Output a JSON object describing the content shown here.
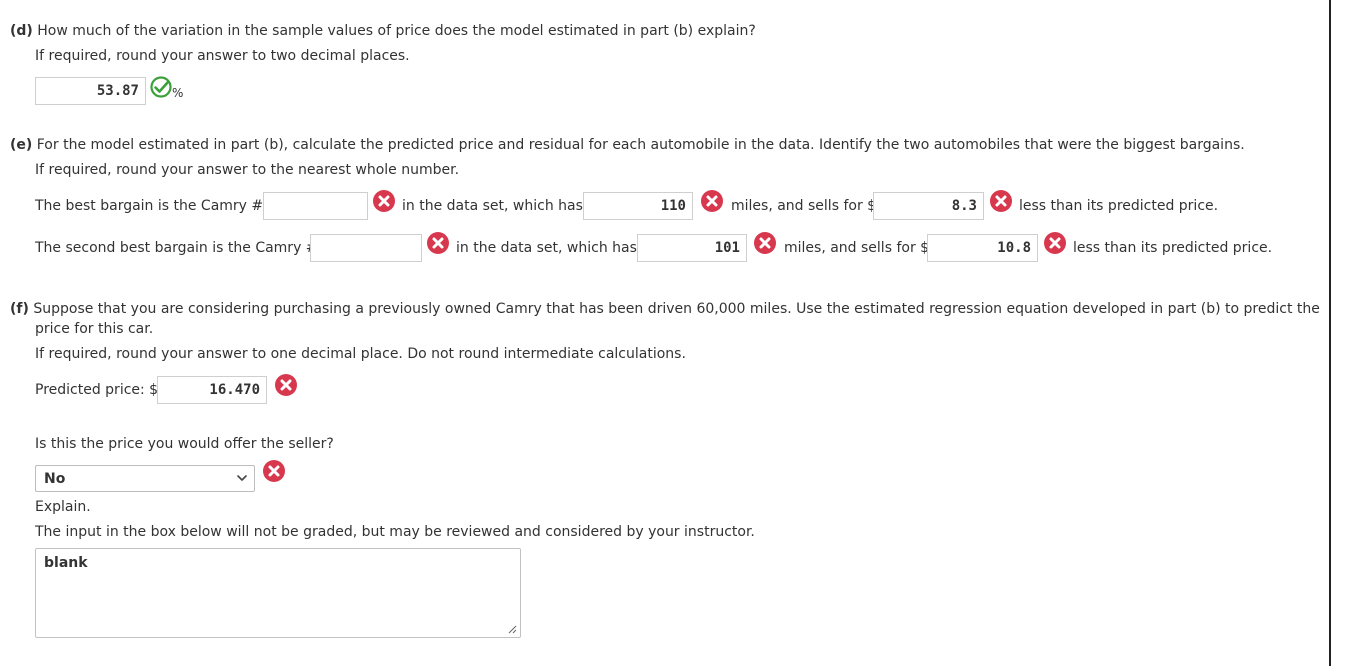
{
  "part_d": {
    "label": "(d)",
    "question": "How much of the variation in the sample values of price does the model estimated in part (b) explain?",
    "instruction": "If required, round your answer to two decimal places.",
    "answer": "53.87",
    "unit": "%"
  },
  "part_e": {
    "label": "(e)",
    "question": "For the model estimated in part (b), calculate the predicted price and residual for each automobile in the data. Identify the two automobiles that were the biggest bargains.",
    "instruction": "If required, round your answer to the nearest whole number.",
    "row1": {
      "prefix": "The best bargain is the Camry #",
      "camry_value": "",
      "text_after_camry": "in the data set, which has",
      "miles_value": "110",
      "text_after_miles": "miles, and sells for $",
      "price_value": "8.3",
      "text_after_price": "less than its predicted price."
    },
    "row2": {
      "prefix": "The second best bargain is the Camry #",
      "camry_value": "",
      "text_after_camry": "in the data set, which has",
      "miles_value": "101",
      "text_after_miles": "miles, and sells for $",
      "price_value": "10.8",
      "text_after_price": "less than its predicted price."
    }
  },
  "part_f": {
    "label": "(f)",
    "question_line1": "Suppose that you are considering purchasing a previously owned Camry that has been driven 60,000 miles. Use the estimated regression equation developed in part (b) to predict the",
    "question_line2": "price for this car.",
    "instruction": "If required, round your answer to one decimal place. Do not round intermediate calculations.",
    "predicted_label": "Predicted price: $",
    "predicted_value": "16.470",
    "offer_question": "Is this the price you would offer the seller?",
    "offer_selected": "No",
    "explain_label": "Explain.",
    "explain_note": "The input in the box below will not be graded, but may be reviewed and considered by your instructor.",
    "explain_text": "blank"
  },
  "colors": {
    "correct": "#3aa13a",
    "incorrect": "#d8384e",
    "border": "#cfcfcf"
  },
  "icons": {
    "correct": "checkmark-icon",
    "incorrect": "x-circle-icon"
  }
}
